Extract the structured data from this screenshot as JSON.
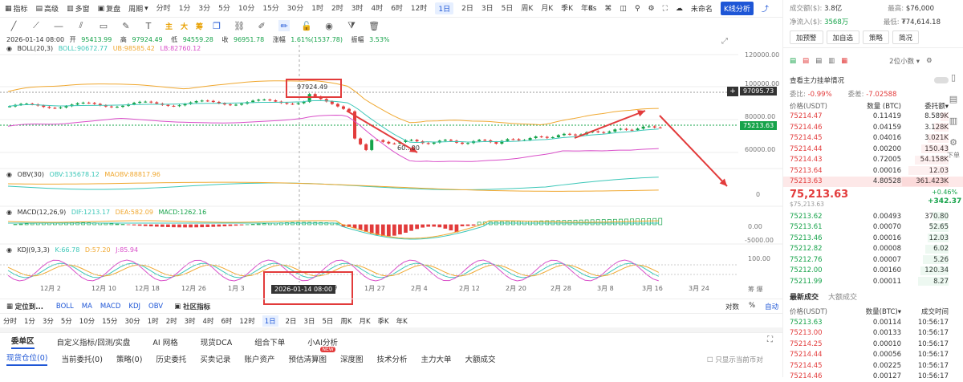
{
  "toolbar": {
    "indicator": "指标",
    "advanced": "高级",
    "multi_window": "多窗",
    "replay": "复盘",
    "period_label": "周期",
    "periods": [
      "分时",
      "1分",
      "3分",
      "5分",
      "10分",
      "15分",
      "30分",
      "1时",
      "2时",
      "3时",
      "4时",
      "6时",
      "12时",
      "1日",
      "2日",
      "3日",
      "5日",
      "周K",
      "月K",
      "季K",
      "年K"
    ],
    "active_period": "1日",
    "os_label": "0s",
    "unnamed": "未命名",
    "kline_analysis": "K线分析"
  },
  "draw_tags": {
    "zhu": "主",
    "da": "大",
    "chou": "筹"
  },
  "ohlc": {
    "date": "2026-01-14 08:00",
    "open_label": "开",
    "open": "95413.99",
    "high_label": "高",
    "high": "97924.49",
    "low_label": "低",
    "low": "94559.28",
    "close_label": "收",
    "close": "96951.78",
    "chg_label": "涨幅",
    "chg": "1.61%(1537.78)",
    "amp_label": "振幅",
    "amp": "3.53%"
  },
  "boll": {
    "label": "BOLL(20,3)",
    "mid": "BOLL:90672.77",
    "ub": "UB:98585.42",
    "lb": "LB:82760.12"
  },
  "obv": {
    "label": "OBV(30)",
    "obv": "OBV:135678.12",
    "maobv": "MAOBV:88817.96"
  },
  "macd": {
    "label": "MACD(12,26,9)",
    "dif": "DIF:1213.17",
    "dea": "DEA:582.09",
    "macd": "MACD:1262.16"
  },
  "kdj": {
    "label": "KDJ(9,3,3)",
    "k": "K:66.78",
    "d": "D:57.20",
    "j": "J:85.94"
  },
  "price_axis": {
    "p120": "120000.00",
    "p100": "100000.00",
    "p80": "80000.00",
    "p60": "60000.00",
    "obv0": "0",
    "macd0": "0.00",
    "macdm": "-5000.00",
    "kdj100": "100.00"
  },
  "labels": {
    "high_mark": "97924.49",
    "low_mark": "60...00",
    "cross_price": "97095.73",
    "last_price": "75213.63",
    "crosshair_date": "2026-01-14 08:00"
  },
  "xaxis": [
    "12月 2",
    "12月 10",
    "12月 18",
    "12月 26",
    "1月 3",
    "19",
    "1月 27",
    "2月 4",
    "2月 12",
    "2月 20",
    "2月 28",
    "3月 8",
    "3月 16",
    "3月 24"
  ],
  "bottom_bar": {
    "locate": "定位到...",
    "items": [
      "BOLL",
      "MA",
      "MACD",
      "KDJ",
      "OBV"
    ],
    "community": "社区指标",
    "right": [
      "对数",
      "%",
      "自动"
    ]
  },
  "period_bar": [
    "分时",
    "1分",
    "3分",
    "5分",
    "10分",
    "15分",
    "30分",
    "1时",
    "2时",
    "3时",
    "4时",
    "6时",
    "12时",
    "1日",
    "2日",
    "3日",
    "5日",
    "周K",
    "月K",
    "季K",
    "年K"
  ],
  "tabs1": [
    "委单区",
    "自定义指标/回测/实盘",
    "AI 网格",
    "现货DCA",
    "组合下单",
    "小AI分析"
  ],
  "tabs2": [
    "现货仓位(0)",
    "当前委托(0)",
    "策略(0)",
    "历史委托",
    "买卖记录",
    "账户资产",
    "预估清算图",
    "深度图",
    "技术分析",
    "主力大单",
    "大额成交"
  ],
  "new_badge": "NEW",
  "only_current": "只显示当前币对",
  "right_panel": {
    "vol_label": "成交额($):",
    "vol": "3.8亿",
    "net_label": "净流入($):",
    "net": "3568万",
    "high_label": "最高:",
    "high": "$76,000",
    "low_label": "最低:",
    "low": "₮74,614.18",
    "buttons": [
      "加预警",
      "加自选",
      "策略",
      "简况"
    ],
    "decimals": "2位小数",
    "main_pending": "查看主力挂单情况",
    "ratio_label": "委比:",
    "ratio": "-0.99%",
    "diff_label": "委差:",
    "diff": "-7.02588",
    "col_price": "价格(USDT)",
    "col_qty": "数量 (BTC)",
    "col_amt": "委托额",
    "asks": [
      [
        "75214.47",
        "0.11419",
        "8.589K"
      ],
      [
        "75214.46",
        "0.04159",
        "3.128K"
      ],
      [
        "75214.45",
        "0.04016",
        "3.021K"
      ],
      [
        "75214.44",
        "0.00200",
        "150.43"
      ],
      [
        "75214.43",
        "0.72005",
        "54.158K"
      ],
      [
        "75213.64",
        "0.00016",
        "12.03"
      ],
      [
        "75213.63",
        "4.80528",
        "361.423K"
      ]
    ],
    "last": "75,213.63",
    "last_usd": "$75,213.63",
    "pct": "+0.46%",
    "chg": "+342.37",
    "bids": [
      [
        "75213.62",
        "0.00493",
        "370.80"
      ],
      [
        "75213.61",
        "0.00070",
        "52.65"
      ],
      [
        "75213.46",
        "0.00016",
        "12.03"
      ],
      [
        "75212.82",
        "0.00008",
        "6.02"
      ],
      [
        "75212.76",
        "0.00007",
        "5.26"
      ],
      [
        "75212.00",
        "0.00160",
        "120.34"
      ],
      [
        "75211.99",
        "0.00011",
        "8.27"
      ]
    ],
    "trades_tab": "最新成交",
    "big_tab": "大额成交",
    "t_col_price": "价格(USDT)",
    "t_col_qty": "数量(BTC)",
    "t_col_time": "成交时间",
    "trades": [
      [
        "75213.63",
        "0.00114",
        "10:56:17"
      ],
      [
        "75213.00",
        "0.00133",
        "10:56:17"
      ],
      [
        "75214.25",
        "0.00010",
        "10:56:17"
      ],
      [
        "75214.44",
        "0.00056",
        "10:56:17"
      ],
      [
        "75214.45",
        "0.00225",
        "10:56:17"
      ],
      [
        "75214.46",
        "0.00127",
        "10:56:17"
      ]
    ],
    "side_icons": [
      "下单"
    ]
  },
  "colors": {
    "up": "#16a34a",
    "down": "#e23b3b",
    "boll_ub": "#f0a830",
    "boll_mid": "#3cc7b8",
    "boll_lb": "#d94fc9",
    "accent": "#1e56d6"
  }
}
